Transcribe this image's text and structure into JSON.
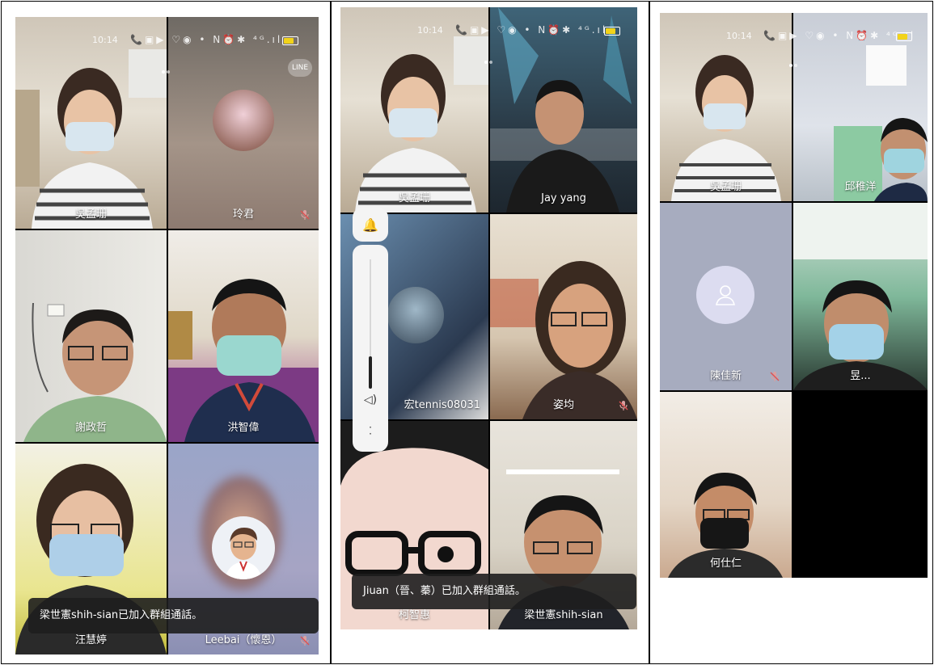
{
  "screens": [
    {
      "status": {
        "time": "10:14",
        "icons": "📞▣▶ ♡◉ • N⏰✱ ⁴ᴳ.ıl"
      },
      "line_badge": "LINE",
      "participants": [
        {
          "name": "吳孟珊"
        },
        {
          "name": "玲君"
        },
        {
          "name": "謝政哲"
        },
        {
          "name": "洪智偉"
        },
        {
          "name": "汪慧婷"
        },
        {
          "name": "Leebai（懷恩）"
        }
      ],
      "toast": "梁世憲shih-sian已加入群組通話。"
    },
    {
      "status": {
        "time": "10:14",
        "icons": "📞▣▶ ♡◉ • N⏰✱ ⁴ᴳ.ıl"
      },
      "participants": [
        {
          "name": "吳孟珊"
        },
        {
          "name": "Jay yang"
        },
        {
          "name": "宏tennis08031"
        },
        {
          "name": "姿均"
        },
        {
          "name": "柯智惠"
        },
        {
          "name": "梁世憲shih-sian"
        }
      ],
      "volume": {
        "level": 0.25
      },
      "toast": "Jiuan（晉、蓁）已加入群組通話。"
    },
    {
      "status": {
        "time": "10:14",
        "icons": "📞▣▶ ♡◉ • N⏰✱ ⁴ᴳ.ıl"
      },
      "participants": [
        {
          "name": "吳孟珊"
        },
        {
          "name": "邱稚洋"
        },
        {
          "name": "陳佳新"
        },
        {
          "name": "昱..."
        },
        {
          "name": "何仕仁"
        }
      ]
    }
  ]
}
